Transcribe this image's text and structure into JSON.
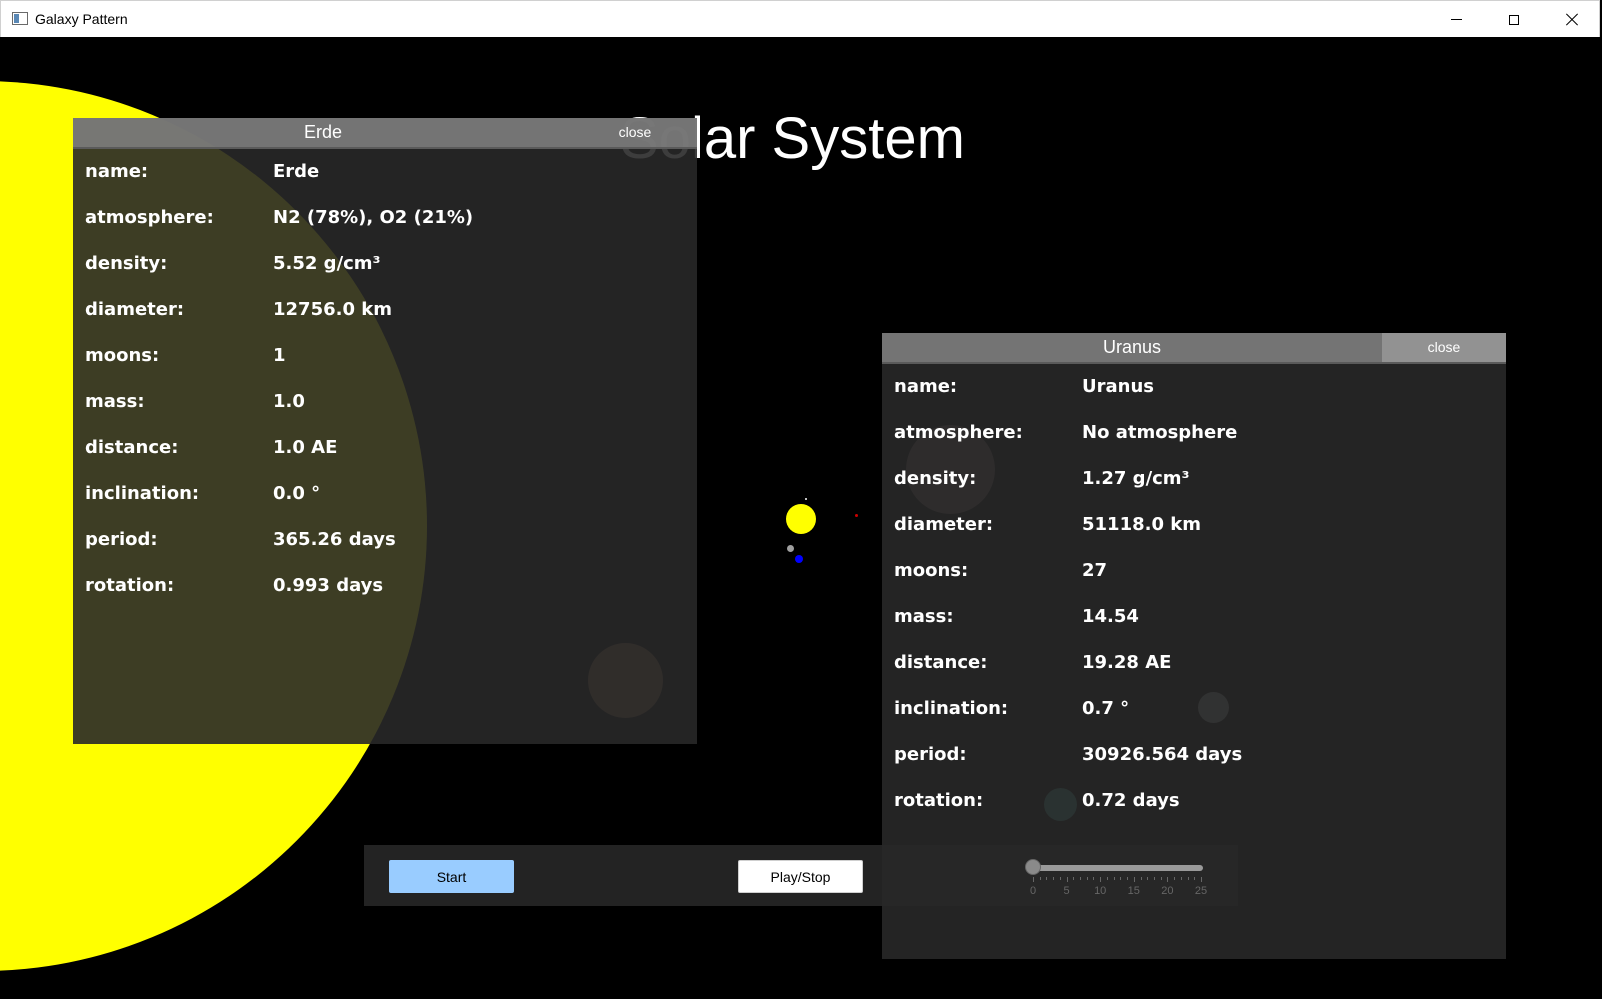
{
  "window": {
    "title": "Galaxy Pattern"
  },
  "scene": {
    "title": "Solar System",
    "colors": {
      "background": "#000000",
      "sun": "#ffff00"
    }
  },
  "erde_panel": {
    "title": "Erde",
    "close_label": "close",
    "rows": [
      {
        "key": "name:",
        "value": "Erde"
      },
      {
        "key": "atmosphere:",
        "value": "N2 (78%), O2 (21%)"
      },
      {
        "key": "density:",
        "value": "5.52 g/cm³"
      },
      {
        "key": "diameter:",
        "value": "12756.0 km"
      },
      {
        "key": "moons:",
        "value": "1"
      },
      {
        "key": "mass:",
        "value": "1.0"
      },
      {
        "key": "distance:",
        "value": "1.0 AE"
      },
      {
        "key": "inclination:",
        "value": "0.0 °"
      },
      {
        "key": "period:",
        "value": "365.26 days"
      },
      {
        "key": "rotation:",
        "value": "0.993 days"
      }
    ]
  },
  "uranus_panel": {
    "title": "Uranus",
    "close_label": "close",
    "rows": [
      {
        "key": "name:",
        "value": "Uranus"
      },
      {
        "key": "atmosphere:",
        "value": "No atmosphere"
      },
      {
        "key": "density:",
        "value": "1.27 g/cm³"
      },
      {
        "key": "diameter:",
        "value": "51118.0 km"
      },
      {
        "key": "moons:",
        "value": "27"
      },
      {
        "key": "mass:",
        "value": "14.54"
      },
      {
        "key": "distance:",
        "value": "19.28 AE"
      },
      {
        "key": "inclination:",
        "value": "0.7 °"
      },
      {
        "key": "period:",
        "value": "30926.564 days"
      },
      {
        "key": "rotation:",
        "value": "0.72 days"
      }
    ]
  },
  "controls": {
    "start_label": "Start",
    "play_label": "Play/Stop",
    "speed_slider": {
      "value": 0,
      "min": 0,
      "max": 25,
      "tick_labels": [
        "0",
        "5",
        "10",
        "15",
        "20",
        "25"
      ]
    }
  }
}
